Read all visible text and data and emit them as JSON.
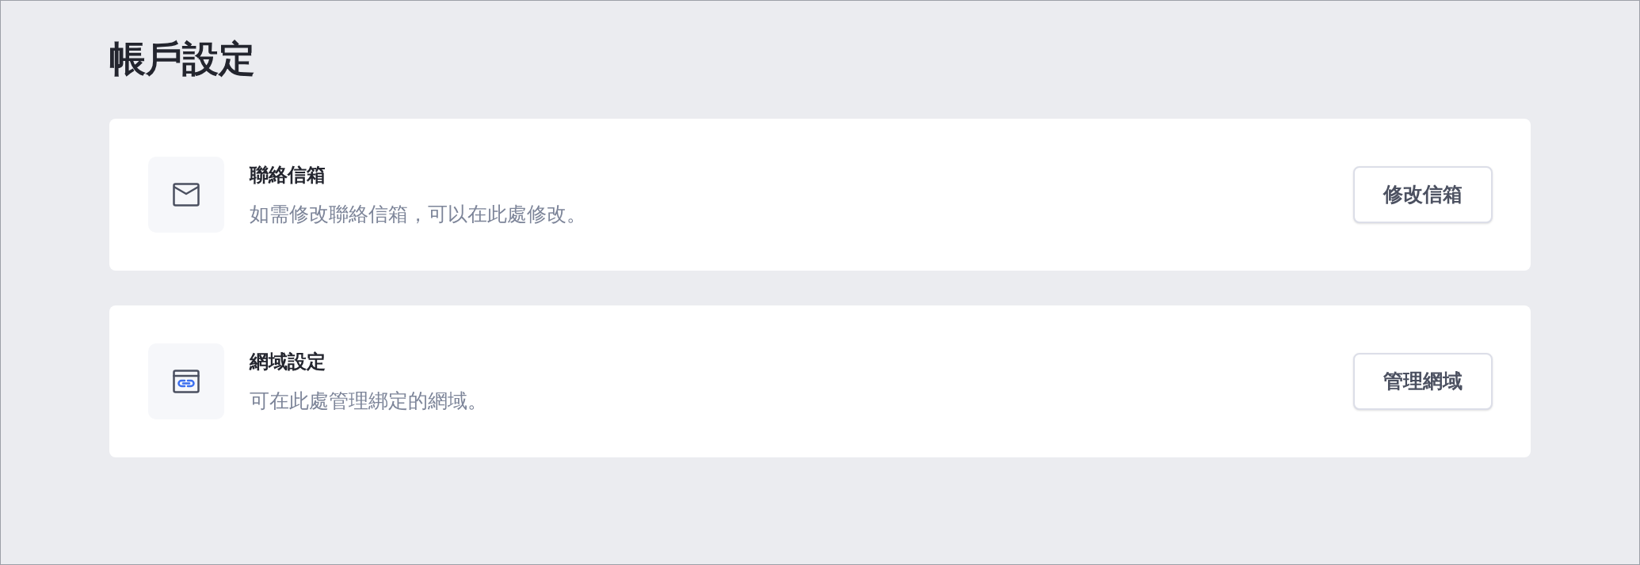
{
  "page": {
    "title": "帳戶設定"
  },
  "sections": [
    {
      "kind": "mail",
      "title": "聯絡信箱",
      "description": "如需修改聯絡信箱，可以在此處修改。",
      "button": "修改信箱"
    },
    {
      "kind": "domain",
      "title": "網域設定",
      "description": "可在此處管理綁定的網域。",
      "button": "管理網域"
    }
  ]
}
